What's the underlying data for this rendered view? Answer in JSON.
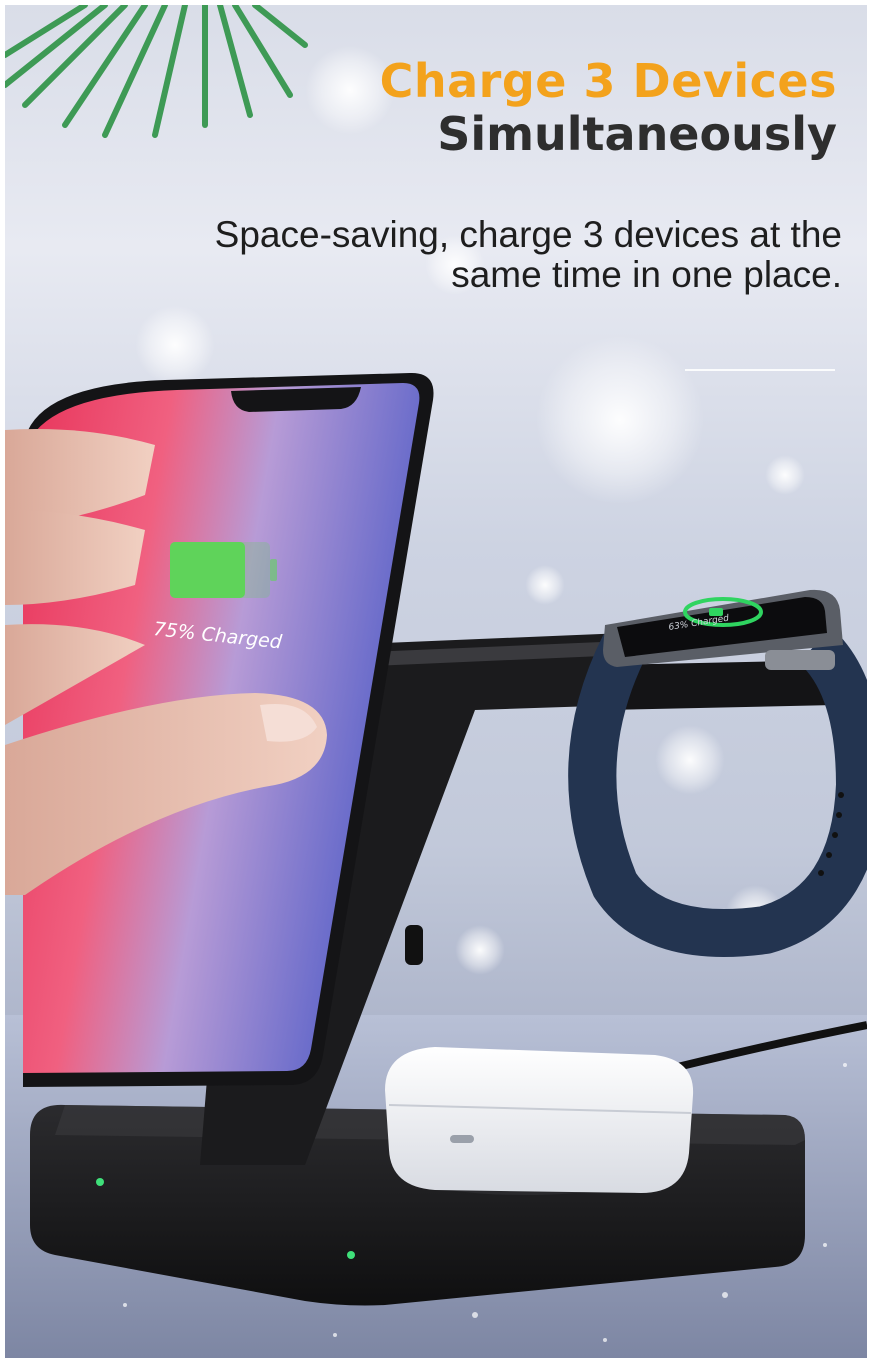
{
  "headline": {
    "line1": "Charge 3 Devices",
    "line2": "Simultaneously"
  },
  "subtitle": {
    "line1": "Space-saving, charge 3 devices at the",
    "line2": "same time in one place."
  },
  "phone_screen": {
    "charge_text": "75% Charged",
    "battery_level": 0.75
  },
  "watch_screen": {
    "charge_text": "63% Charged"
  },
  "colors": {
    "headline_accent": "#f3a21c",
    "headline_dark": "#2e2e2e",
    "charger_body": "#1b1b1d",
    "battery_green": "#5fd35a",
    "led_green": "#3fe07a",
    "watch_band": "#233450"
  }
}
